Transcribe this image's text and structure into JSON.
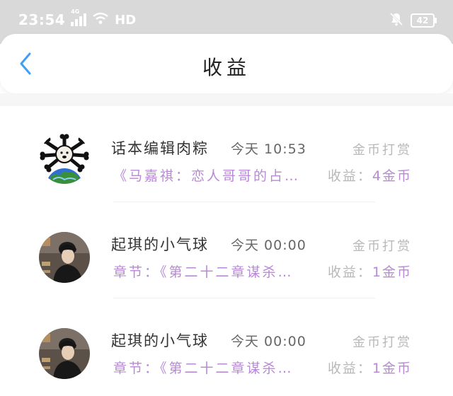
{
  "status_bar": {
    "time": "23:54",
    "network": "4G",
    "hd": "HD",
    "battery": "42",
    "icons": [
      "signal-icon",
      "wifi-icon",
      "mute-icon",
      "battery-icon"
    ]
  },
  "header": {
    "title": "收益",
    "back_icon": "chevron-left-icon",
    "accent_color": "#3d9ff5"
  },
  "colors": {
    "purple_text": "#b889d6",
    "gray_text": "#b8b8b8"
  },
  "items": [
    {
      "name": "话本编辑肉粽",
      "time": "今天 10:53",
      "type": "金币打赏",
      "desc": "《马嘉祺：恋人哥哥的占…",
      "earn_label": "收益：",
      "earn_value": "4金币",
      "avatar": "cartoon-avatar"
    },
    {
      "name": "起琪的小气球",
      "time": "今天 00:00",
      "type": "金币打赏",
      "desc": "章节：《第二十二章谋杀…",
      "earn_label": "收益：",
      "earn_value": "1金币",
      "avatar": "photo-avatar"
    },
    {
      "name": "起琪的小气球",
      "time": "今天 00:00",
      "type": "金币打赏",
      "desc": "章节：《第二十二章谋杀…",
      "earn_label": "收益：",
      "earn_value": "1金币",
      "avatar": "photo-avatar"
    }
  ]
}
